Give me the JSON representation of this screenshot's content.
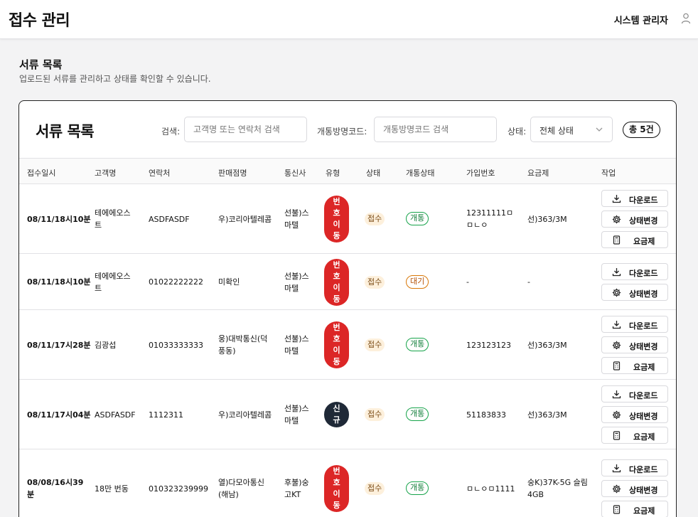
{
  "header": {
    "title": "접수 관리",
    "user_name": "시스템 관리자",
    "user_icon": "user-icon"
  },
  "page": {
    "heading": "서류 목록",
    "description": "업로드된 서류를 관리하고 상태를 확인할 수 있습니다."
  },
  "card": {
    "title": "서류 목록",
    "search_label": "검색:",
    "search_placeholder": "고객명 또는 연락처 검색",
    "code_label": "개통방명코드:",
    "code_placeholder": "개통방명코드 검색",
    "status_label": "상태:",
    "status_value": "전체 상태",
    "total": "총 5건"
  },
  "columns": [
    "접수일시",
    "고객명",
    "연락처",
    "판매점명",
    "통신사",
    "유형",
    "상태",
    "개통상태",
    "가입번호",
    "요금제",
    "작업"
  ],
  "actions": {
    "download": "다운로드",
    "change_status": "상태변경",
    "plan": "요금제"
  },
  "colors": {
    "type_transfer": "#dc2626",
    "type_new": "#1f2937",
    "activation_done": "#16a34a",
    "activation_wait": "#d97706"
  },
  "rows": [
    {
      "date": "08/11/18시10분",
      "customer": "테에에오스\n트",
      "phone": "ASDFASDF",
      "store": "우)코리아텔레콤",
      "carrier": "선불)스\n마텔",
      "type": "번호이동",
      "status": "접수",
      "activation": "개통",
      "subscription": "12311111ㅁ\nㅁㄴㅇ",
      "plan": "선)363/3M"
    },
    {
      "date": "08/11/18시10분",
      "customer": "테에에오스\n트",
      "phone": "01022222222",
      "store": "미확인",
      "carrier": "선불)스\n마텔",
      "type": "번호이동",
      "status": "접수",
      "activation": "대기",
      "subscription": "-",
      "plan": "-"
    },
    {
      "date": "08/11/17시28분",
      "customer": "김광섭",
      "phone": "01033333333",
      "store": "웅)대박통신(덕\n풍동)",
      "carrier": "선불)스\n마텔",
      "type": "번호이동",
      "status": "접수",
      "activation": "개통",
      "subscription": "123123123",
      "plan": "선)363/3M"
    },
    {
      "date": "08/11/17시04분",
      "customer": "ASDFASDF",
      "phone": "1112311",
      "store": "우)코리아텔레콤",
      "carrier": "선불)스\n마텔",
      "type": "신규",
      "status": "접수",
      "activation": "개통",
      "subscription": "51183833",
      "plan": "선)363/3M"
    },
    {
      "date": "08/08/16시39\n분",
      "customer": "18만 번동",
      "phone": "010323239999",
      "store": "열)다모아통신\n(해남)",
      "carrier": "후불)숭\n고KT",
      "type": "번호이동",
      "status": "접수",
      "activation": "개통",
      "subscription": "ㅁㄴㅇㅁ1111",
      "plan": "숭K)37K-5G 슬림\n4GB"
    }
  ]
}
